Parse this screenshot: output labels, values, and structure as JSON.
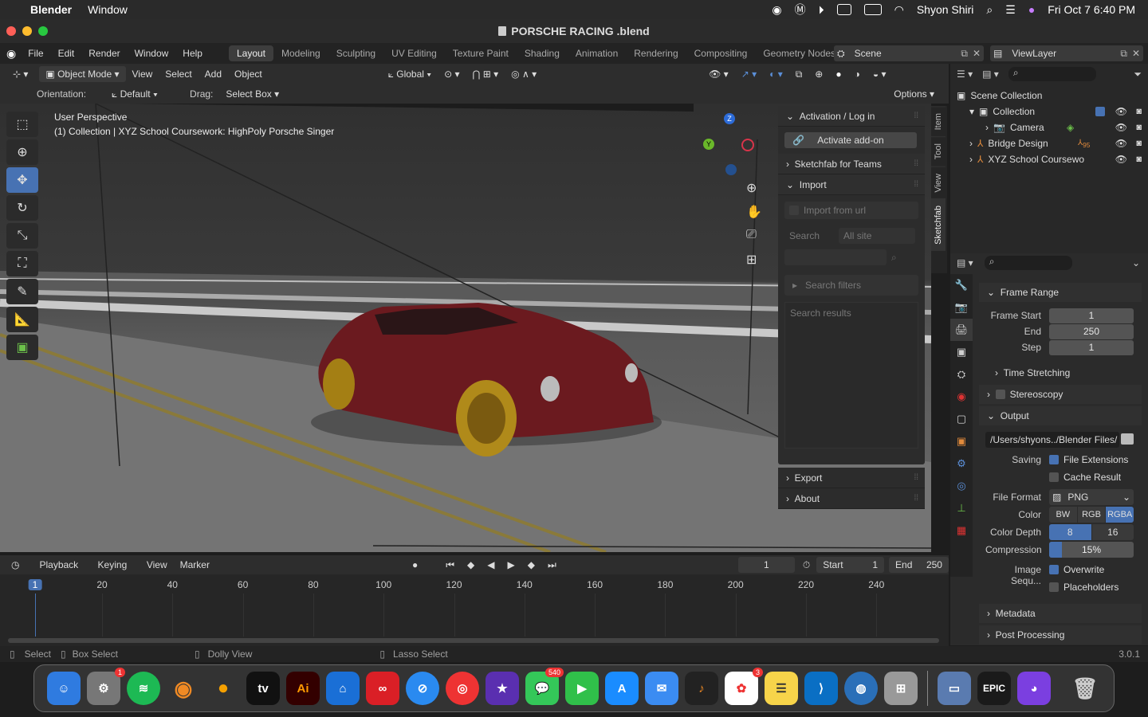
{
  "menubar": {
    "app": "Blender",
    "items": [
      "Window"
    ],
    "user": "Shyon Shiri",
    "datetime": "Fri Oct 7  6:40 PM"
  },
  "window": {
    "title": "PORSCHE RACING .blend"
  },
  "topmenu": {
    "items": [
      "File",
      "Edit",
      "Render",
      "Window",
      "Help"
    ]
  },
  "workspaces": [
    "Layout",
    "Modeling",
    "Sculpting",
    "UV Editing",
    "Texture Paint",
    "Shading",
    "Animation",
    "Rendering",
    "Compositing",
    "Geometry Nodes"
  ],
  "scene": {
    "label": "Scene",
    "viewlayer": "ViewLayer"
  },
  "viewport_header": {
    "mode": "Object Mode",
    "menus": [
      "View",
      "Select",
      "Add",
      "Object"
    ],
    "transform": "Global"
  },
  "tool_settings": {
    "orientation_label": "Orientation:",
    "orientation": "Default",
    "drag_label": "Drag:",
    "drag": "Select Box",
    "options": "Options"
  },
  "viewport": {
    "perspective": "User Perspective",
    "collection": "(1) Collection | XYZ School Coursework: HighPoly Porsche Singer"
  },
  "gizmo": {
    "z": "Z",
    "y": "Y"
  },
  "npanel": {
    "activation": "Activation / Log in",
    "activate_btn": "Activate add-on",
    "teams": "Sketchfab for Teams",
    "import": "Import",
    "import_url": "Import from url",
    "search_label": "Search",
    "search_scope": "All site",
    "search_filters": "Search filters",
    "search_results": "Search results",
    "export": "Export",
    "about": "About"
  },
  "ntabs": [
    "Item",
    "Tool",
    "View",
    "Sketchfab"
  ],
  "outliner": {
    "root": "Scene Collection",
    "items": [
      {
        "label": "Collection"
      },
      {
        "label": "Camera"
      },
      {
        "label": "Bridge Design"
      },
      {
        "label": "XYZ School Coursewo"
      }
    ],
    "bridge_badge": "95"
  },
  "properties": {
    "frame_range": "Frame Range",
    "frame_start_label": "Frame Start",
    "frame_start": "1",
    "end_label": "End",
    "end": "250",
    "step_label": "Step",
    "step": "1",
    "time_stretching": "Time Stretching",
    "stereoscopy": "Stereoscopy",
    "output": "Output",
    "path": "/Users/shyons../Blender Files/",
    "saving_label": "Saving",
    "file_extensions": "File Extensions",
    "cache_result": "Cache Result",
    "file_format_label": "File Format",
    "file_format": "PNG",
    "color_label": "Color",
    "color_opts": [
      "BW",
      "RGB",
      "RGBA"
    ],
    "depth_label": "Color Depth",
    "depth_opts": [
      "8",
      "16"
    ],
    "compression_label": "Compression",
    "compression": "15%",
    "image_seq_label": "Image Sequ...",
    "overwrite": "Overwrite",
    "placeholders": "Placeholders",
    "metadata": "Metadata",
    "post_processing": "Post Processing"
  },
  "timeline": {
    "menus": [
      "Playback",
      "Keying",
      "View",
      "Marker"
    ],
    "current_frame": "1",
    "start_label": "Start",
    "start": "1",
    "end_label": "End",
    "end": "250",
    "ticks": [
      "1",
      "20",
      "40",
      "60",
      "80",
      "100",
      "120",
      "140",
      "160",
      "180",
      "200",
      "220",
      "240"
    ]
  },
  "statusbar": {
    "select": "Select",
    "box_select": "Box Select",
    "dolly": "Dolly View",
    "lasso": "Lasso Select",
    "version": "3.0.1"
  },
  "dock": {
    "badges": {
      "settings": "1",
      "messages": "540",
      "photos": "3"
    },
    "apps": [
      "Finder",
      "System Preferences",
      "Spotify",
      "Blender",
      "Miro",
      "Apple TV",
      "Illustrator",
      "Keynote",
      "Creative Cloud",
      "Safari",
      "Chrome",
      "iMovie",
      "Messages",
      "FaceTime",
      "App Store",
      "Mail",
      "GarageBand",
      "Photos",
      "Notes",
      "VS Code",
      "Globe",
      "Launchpad",
      "Screen",
      "Epic Games",
      "GitHub Desktop",
      "Trash"
    ],
    "ai": "Ai",
    "epic": "EPIC"
  }
}
